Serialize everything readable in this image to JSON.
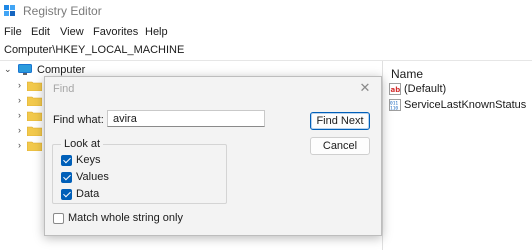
{
  "window": {
    "title": "Registry Editor",
    "app_icon": "regedit-icon"
  },
  "menu": {
    "file": "File",
    "edit": "Edit",
    "view": "View",
    "favorites": "Favorites",
    "help": "Help"
  },
  "address": {
    "path": "Computer\\HKEY_LOCAL_MACHINE"
  },
  "tree": {
    "root_label": "Computer",
    "collapsed_folder_count": 5,
    "folder_color": "#f2c94c"
  },
  "values_pane": {
    "column_name": "Name",
    "rows": [
      {
        "label": "(Default)",
        "icon": "string-value-icon"
      },
      {
        "label": "ServiceLastKnownStatus",
        "icon": "binary-value-icon"
      }
    ]
  },
  "find_dialog": {
    "title": "Find",
    "close_icon": "close-icon",
    "find_what_label": "Find what:",
    "find_what_value": "avira",
    "find_next_label": "Find Next",
    "cancel_label": "Cancel",
    "look_at_label": "Look at",
    "options": [
      {
        "label": "Keys",
        "checked": true
      },
      {
        "label": "Values",
        "checked": true
      },
      {
        "label": "Data",
        "checked": true
      }
    ],
    "match_whole_label": "Match whole string only",
    "match_whole_checked": false
  },
  "colors": {
    "accent": "#005fb8",
    "dialog_bg": "#f3f3f3"
  }
}
